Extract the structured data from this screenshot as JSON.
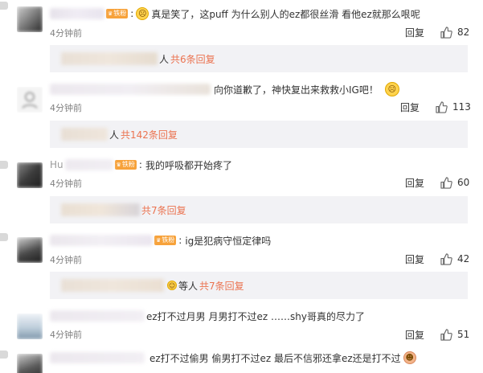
{
  "colors": {
    "accent": "#eb7350",
    "badge": "#f7a23a",
    "sub_bg": "#f2f2f5",
    "muted": "#808080"
  },
  "icons": {
    "like": "thumb-up-icon",
    "badge": "crown-icon"
  },
  "comments": [
    {
      "badge": "铁粉",
      "emoji": "sad-face-emoji",
      "text": "真是笑了，这puff 为什么别人的ez都很丝滑 看他ez就那么哏呢",
      "time": "4分钟前",
      "reply": "回复",
      "likes": "82",
      "sub_suffix": "人",
      "sub_more": "共6条回复"
    },
    {
      "text": "向你道歉了，神快复出来救救小IG吧！",
      "emoji_after": "sad-face-emoji",
      "time": "4分钟前",
      "reply": "回复",
      "likes": "113",
      "sub_suffix": "人",
      "sub_more": "共142条回复"
    },
    {
      "name_prefix": "Hu",
      "badge": "铁粉",
      "text": "我的呼吸都开始疼了",
      "time": "4分钟前",
      "reply": "回复",
      "likes": "60",
      "sub_suffix": "",
      "sub_more": "共7条回复"
    },
    {
      "badge": "铁粉",
      "text": "ig是犯病守恒定律吗",
      "time": "4分钟前",
      "reply": "回复",
      "likes": "42",
      "sub_suffix": "等人",
      "sub_more": "共7条回复"
    },
    {
      "text": "ez打不过月男 月男打不过ez ……shy哥真的尽力了",
      "time": "4分钟前",
      "reply": "回复",
      "likes": "51"
    },
    {
      "text": "ez打不过偷男 偷男打不过ez 最后不信邪还拿ez还是打不过",
      "emoji_after": "laughing-face-emoji"
    }
  ]
}
